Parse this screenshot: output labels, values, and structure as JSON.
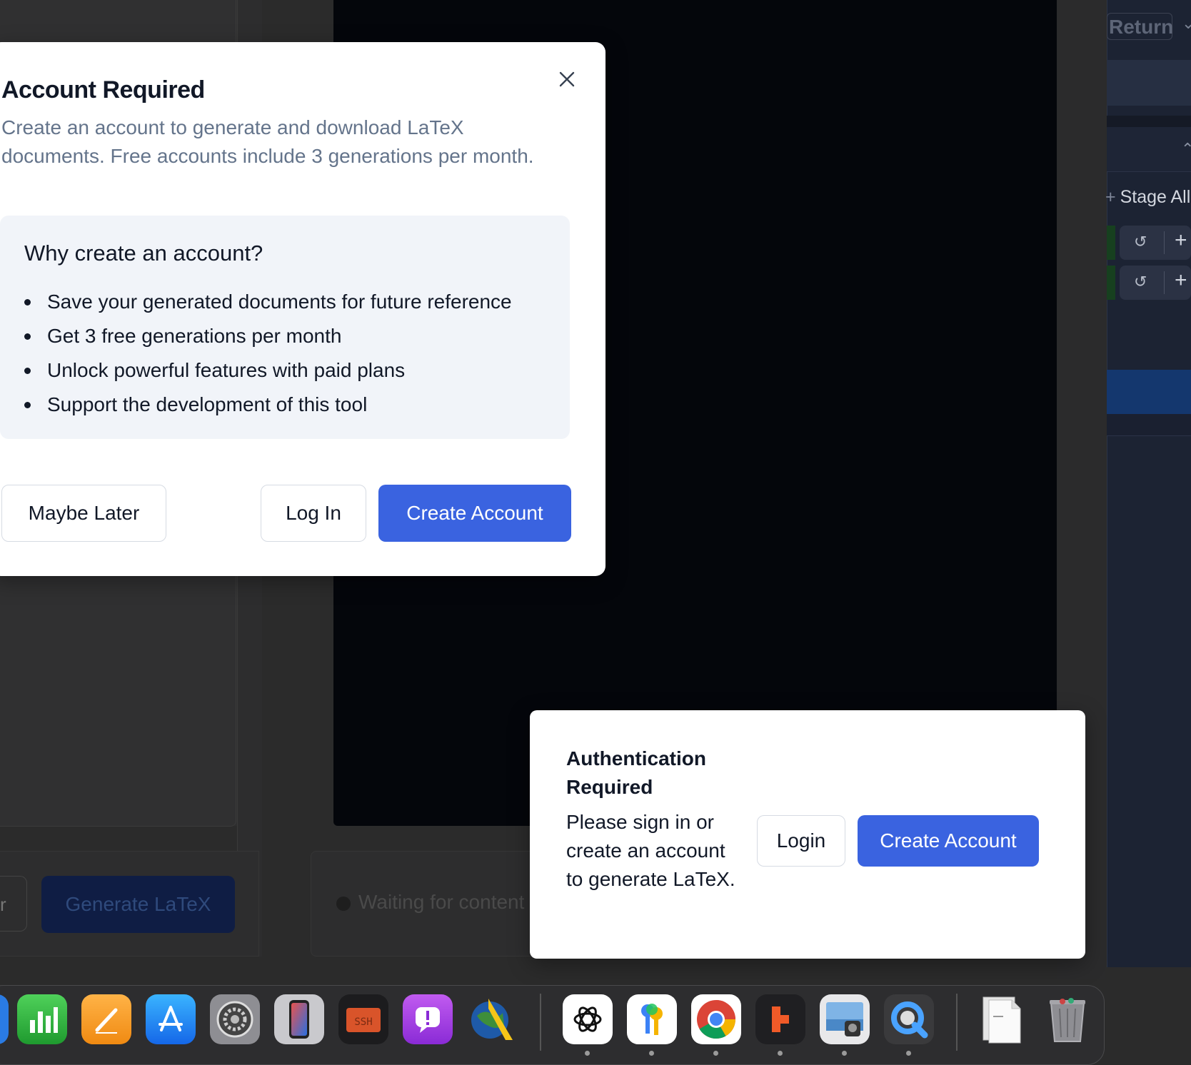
{
  "background": {
    "generate_label": "Generate LaTeX",
    "secondary_label": "r",
    "status_text": "Waiting for content",
    "git": {
      "return_label": "Return",
      "stage_all_label": "Stage All"
    }
  },
  "modal": {
    "title": "Account Required",
    "description": "Create an account to generate and download LaTeX documents. Free accounts include 3 generations per month.",
    "why_title": "Why create an account?",
    "benefits": [
      "Save your generated documents for future reference",
      "Get 3 free generations per month",
      "Unlock powerful features with paid plans",
      "Support the development of this tool"
    ],
    "maybe_later_label": "Maybe Later",
    "login_label": "Log In",
    "create_label": "Create Account"
  },
  "toast": {
    "title": "Authentication Required",
    "description": "Please sign in or create an account to generate LaTeX.",
    "login_label": "Login",
    "create_label": "Create Account"
  },
  "dock": {
    "apps": [
      "numbers-icon",
      "pages-icon",
      "app-store-icon",
      "system-settings-icon",
      "iphone-mirroring-icon",
      "ssh-files-icon",
      "feedback-assistant-icon",
      "google-earth-icon",
      "chatgpt-icon",
      "passwords-icon",
      "chrome-icon",
      "git-app-icon",
      "preview-icon",
      "quicktime-icon",
      "documents-icon",
      "trash-icon"
    ]
  }
}
